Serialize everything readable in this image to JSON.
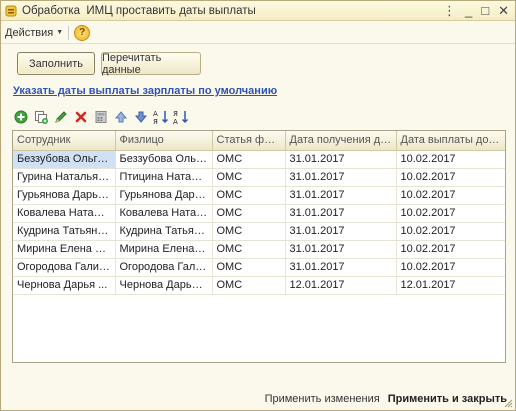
{
  "window": {
    "title": "Обработка  ИМЦ проставить даты выплаты",
    "controls": {
      "menu": "⋮",
      "minimize": "_",
      "maximize": "□",
      "close": "✕"
    }
  },
  "actions_bar": {
    "actions_label": "Действия",
    "help_label": "?"
  },
  "buttons": {
    "fill": "Заполнить",
    "reread": "Перечитать данные"
  },
  "link": {
    "default_dates": "Указать даты выплаты зарплаты по умолчанию"
  },
  "toolbar_icons": [
    "add-icon",
    "copy-icon",
    "edit-icon",
    "delete-icon",
    "calc-icon",
    "move-up-icon",
    "move-down-icon",
    "sort-asc-icon",
    "sort-desc-icon"
  ],
  "table": {
    "columns": [
      "Сотрудник",
      "Физлицо",
      "Статья фина...",
      "Дата получения дохо...",
      "Дата выплаты дохода"
    ],
    "rows": [
      [
        "Беззубова Ольга ...",
        "Беззубова Ольга ...",
        "ОМС",
        "31.01.2017",
        "10.02.2017"
      ],
      [
        "Гурина Наталья Е...",
        "Птицина Наталья...",
        "ОМС",
        "31.01.2017",
        "10.02.2017"
      ],
      [
        "Гурьянова Дарья...",
        "Гурьянова Дарья...",
        "ОМС",
        "31.01.2017",
        "10.02.2017"
      ],
      [
        "Ковалева Натальн...",
        "Ковалева Натальн...",
        "ОМС",
        "31.01.2017",
        "10.02.2017"
      ],
      [
        "Кудрина Татьяна ...",
        "Кудрина Татьяна ...",
        "ОМС",
        "31.01.2017",
        "10.02.2017"
      ],
      [
        "Мирина Елена Ал...",
        "Мирина Елена Ал...",
        "ОМС",
        "31.01.2017",
        "10.02.2017"
      ],
      [
        "Огородова Галин...",
        "Огородова Галин...",
        "ОМС",
        "31.01.2017",
        "10.02.2017"
      ],
      [
        "Чернова Дарья ...",
        "Чернова Дарья ...",
        "ОМС",
        "12.01.2017",
        "12.01.2017"
      ]
    ]
  },
  "footer": {
    "apply": "Применить изменения",
    "apply_close": "Применить и закрыть"
  }
}
